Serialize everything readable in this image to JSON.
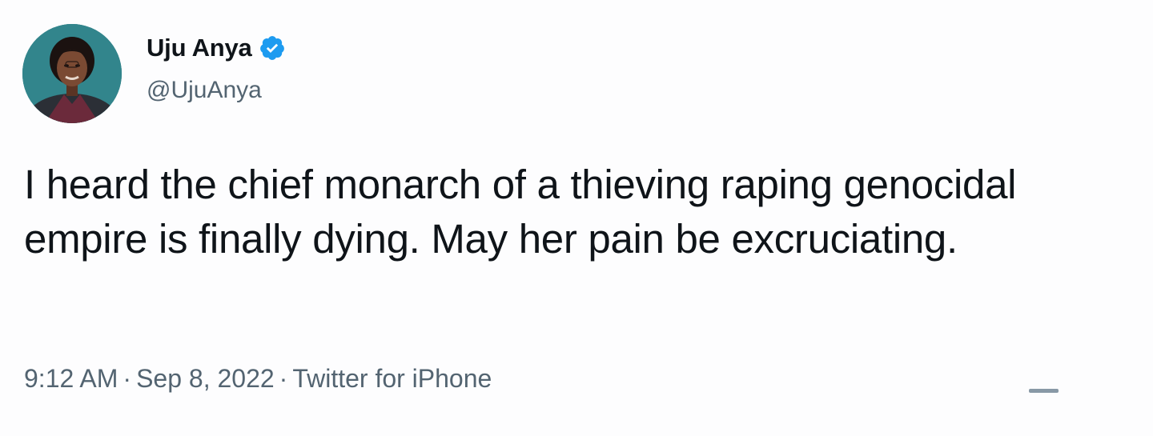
{
  "tweet": {
    "author": {
      "display_name": "Uju Anya",
      "handle": "@UjuAnya",
      "verified": true,
      "verified_icon": "verified-badge-icon"
    },
    "text": "I heard the chief monarch of a thieving raping genocidal empire is finally dying. May her pain be excruciating.",
    "meta": {
      "time": "9:12 AM",
      "separator": "·",
      "date": "Sep 8, 2022",
      "source": "Twitter for iPhone"
    }
  },
  "colors": {
    "text_primary": "#0f1419",
    "text_secondary": "#536471",
    "verified_blue": "#1d9bf0",
    "background": "#fdfdfe"
  }
}
